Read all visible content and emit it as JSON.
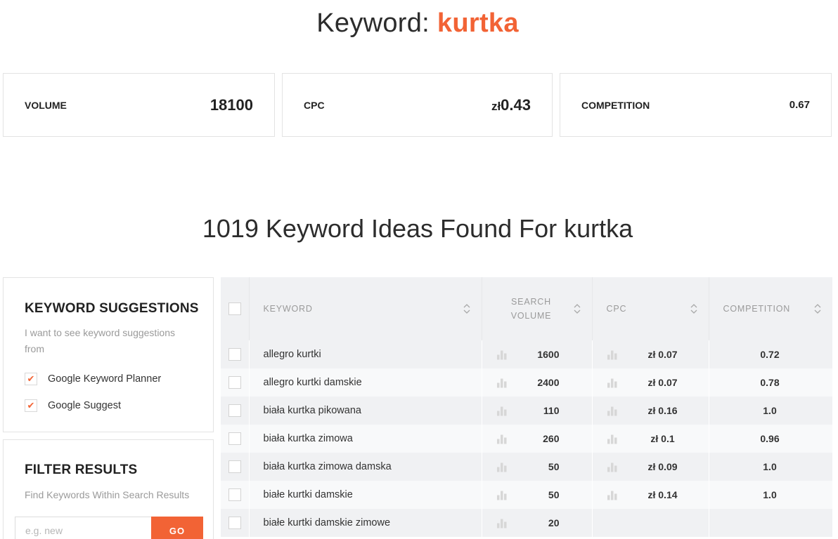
{
  "header": {
    "prefix": "Keyword: ",
    "keyword": "kurtka"
  },
  "metrics": {
    "volume": {
      "label": "VOLUME",
      "value": "18100"
    },
    "cpc": {
      "label": "CPC",
      "currency": "zł",
      "value": "0.43"
    },
    "competition": {
      "label": "COMPETITION",
      "value": "0.67"
    }
  },
  "ideas_title": "1019 Keyword Ideas Found For kurtka",
  "suggestions": {
    "title": "KEYWORD SUGGESTIONS",
    "description": "I want to see keyword suggestions from",
    "options": [
      {
        "label": "Google Keyword Planner",
        "checked": true
      },
      {
        "label": "Google Suggest",
        "checked": true
      }
    ],
    "check_glyph": "✔"
  },
  "filter": {
    "title": "FILTER RESULTS",
    "description": "Find Keywords Within Search Results",
    "placeholder": "e.g. new",
    "button_label": "GO"
  },
  "table": {
    "columns": {
      "keyword": "KEYWORD",
      "search_volume": "SEARCH VOLUME",
      "cpc": "CPC",
      "competition": "COMPETITION"
    },
    "rows": [
      {
        "keyword": "allegro kurtki",
        "volume": "1600",
        "cpc": "zł 0.07",
        "competition": "0.72"
      },
      {
        "keyword": "allegro kurtki damskie",
        "volume": "2400",
        "cpc": "zł 0.07",
        "competition": "0.78"
      },
      {
        "keyword": "biała kurtka pikowana",
        "volume": "110",
        "cpc": "zł 0.16",
        "competition": "1.0"
      },
      {
        "keyword": "biała kurtka zimowa",
        "volume": "260",
        "cpc": "zł 0.1",
        "competition": "0.96"
      },
      {
        "keyword": "biała kurtka zimowa damska",
        "volume": "50",
        "cpc": "zł 0.09",
        "competition": "1.0"
      },
      {
        "keyword": "białe kurtki damskie",
        "volume": "50",
        "cpc": "zł 0.14",
        "competition": "1.0"
      },
      {
        "keyword": "białe kurtki damskie zimowe",
        "volume": "20",
        "cpc": "",
        "competition": ""
      }
    ]
  },
  "colors": {
    "accent": "#f26335",
    "row_shade": "#f0f1f3",
    "row_light": "#f8f9fa"
  }
}
